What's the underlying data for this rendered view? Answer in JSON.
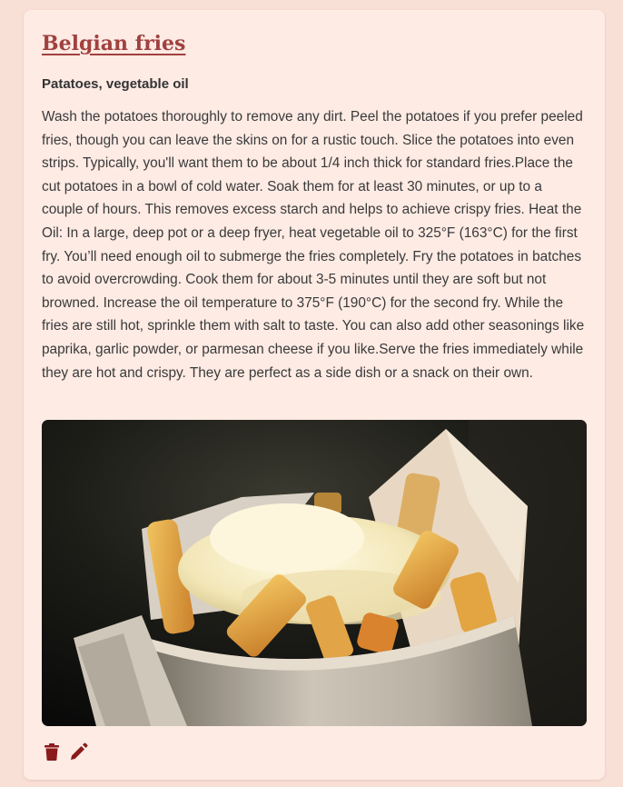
{
  "recipe": {
    "title": "Belgian fries",
    "ingredients": "Patatoes, vegetable oil",
    "instructions": "Wash the potatoes thoroughly to remove any dirt. Peel the potatoes if you prefer peeled fries, though you can leave the skins on for a rustic touch. Slice the potatoes into even strips. Typically, you'll want them to be about 1/4 inch thick for standard fries.Place the cut potatoes in a bowl of cold water. Soak them for at least 30 minutes, or up to a couple of hours. This removes excess starch and helps to achieve crispy fries. Heat the Oil: In a large, deep pot or a deep fryer, heat vegetable oil to 325°F (163°C) for the first fry. You’ll need enough oil to submerge the fries completely. Fry the potatoes in batches to avoid overcrowding. Cook them for about 3-5 minutes until they are soft but not browned. Increase the oil temperature to 375°F (190°C) for the second fry. While the fries are still hot, sprinkle them with salt to taste. You can also add other seasonings like paprika, garlic powder, or parmesan cheese if you like.Serve the fries immediately while they are hot and crispy. They are perfect as a side dish or a snack on their own."
  },
  "actions": {
    "delete_icon": "trash-icon",
    "edit_icon": "pencil-icon",
    "icon_color": "#8b1a1a"
  },
  "colors": {
    "page_bg": "#f9e0d7",
    "card_bg": "#fdebe4",
    "title": "#a1413f"
  }
}
